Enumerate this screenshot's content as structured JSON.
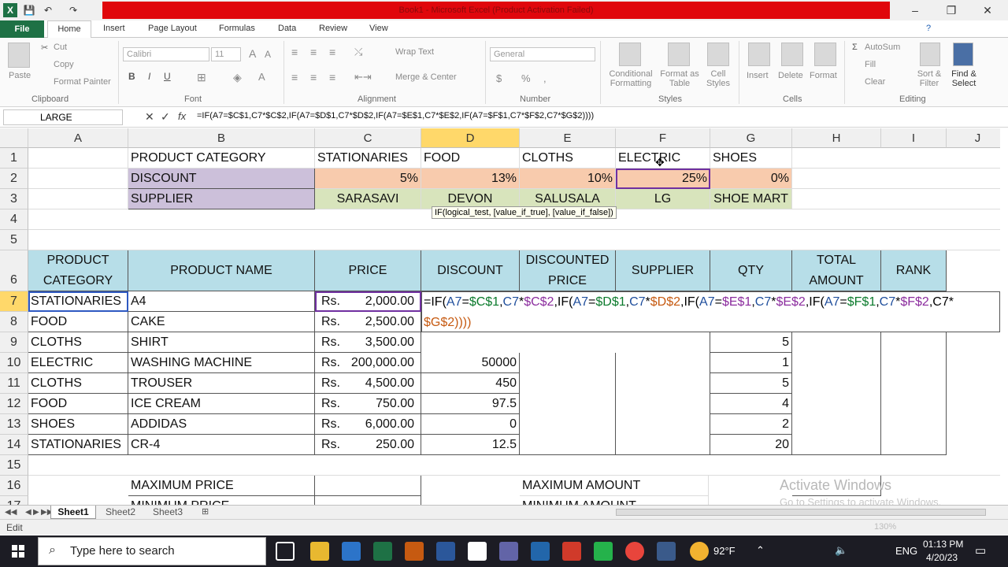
{
  "window": {
    "title_blurred": "Book1 - Microsoft Excel (Product Activation Failed)",
    "qa_excel_icon": "X",
    "qa_save": "💾",
    "qa_undo": "↶",
    "qa_redo": "↷",
    "minimize": "–",
    "restore": "❐",
    "close": "✕"
  },
  "ribbon_tabs": [
    "File",
    "Home",
    "Insert",
    "Page Layout",
    "Formulas",
    "Data",
    "Review",
    "View"
  ],
  "ribbon": {
    "paste": "Paste",
    "cut": "Cut",
    "copy": "Copy",
    "format_painter": "Format Painter",
    "clipboard": "Clipboard",
    "font_name": "Calibri",
    "font_size": "11",
    "font": "Font",
    "wrap_text": "Wrap Text",
    "merge_center": "Merge & Center",
    "alignment": "Alignment",
    "number_format": "General",
    "number": "Number",
    "conditional_formatting": "Conditional Formatting",
    "format_as_table": "Format as Table",
    "cell_styles": "Cell Styles",
    "styles": "Styles",
    "insert": "Insert",
    "delete": "Delete",
    "format": "Format",
    "cells": "Cells",
    "autosum": "AutoSum",
    "fill": "Fill",
    "clear": "Clear",
    "sort_filter": "Sort & Filter",
    "find_select": "Find & Select",
    "editing": "Editing",
    "bold": "B",
    "italic": "I",
    "underline": "U"
  },
  "formula_bar": {
    "name_box": "LARGE",
    "cancel": "✕",
    "enter": "✓",
    "fx": "fx",
    "formula": "=IF(A7=$C$1,C7*$C$2,IF(A7=$D$1,C7*$D$2,IF(A7=$E$1,C7*$E$2,IF(A7=$F$1,C7*$F$2,C7*$G$2))))"
  },
  "columns": [
    "A",
    "B",
    "C",
    "D",
    "E",
    "F",
    "G",
    "H",
    "I",
    "J"
  ],
  "rows": [
    "1",
    "2",
    "3",
    "4",
    "5",
    "6",
    "7",
    "8",
    "9",
    "10",
    "11",
    "12",
    "13",
    "14",
    "15",
    "16",
    "17"
  ],
  "header_table": {
    "b1": "PRODUCT CATEGORY",
    "b2": "DISCOUNT",
    "b3": "SUPPLIER",
    "categories": [
      "STATIONARIES",
      "FOOD",
      "CLOTHS",
      "ELECTRIC",
      "SHOES"
    ],
    "discounts": [
      "5%",
      "13%",
      "10%",
      "25%",
      "0%"
    ],
    "suppliers": [
      "SARASAVI",
      "DEVON",
      "SALUSALA",
      "LG",
      "SHOE MART"
    ]
  },
  "main_table": {
    "headers": {
      "product_category_1": "PRODUCT",
      "product_category_2": "CATEGORY",
      "product_name": "PRODUCT NAME",
      "price": "PRICE",
      "discount": "DISCOUNT",
      "discounted_price_1": "DISCOUNTED",
      "discounted_price_2": "PRICE",
      "supplier": "SUPPLIER",
      "qty": "QTY",
      "total_amount_1": "TOTAL",
      "total_amount_2": "AMOUNT",
      "rank": "RANK"
    },
    "rows": [
      {
        "category": "STATIONARIES",
        "name": "A4",
        "rs": "Rs.",
        "price": "2,000.00",
        "discount": "",
        "qty": ""
      },
      {
        "category": "FOOD",
        "name": "CAKE",
        "rs": "Rs.",
        "price": "2,500.00",
        "discount": "",
        "qty": ""
      },
      {
        "category": "CLOTHS",
        "name": "SHIRT",
        "rs": "Rs.",
        "price": "3,500.00",
        "discount": "",
        "qty": "5"
      },
      {
        "category": "ELECTRIC",
        "name": "WASHING MACHINE",
        "rs": "Rs.",
        "price": "200,000.00",
        "discount": "50000",
        "qty": "1"
      },
      {
        "category": "CLOTHS",
        "name": "TROUSER",
        "rs": "Rs.",
        "price": "4,500.00",
        "discount": "450",
        "qty": "5"
      },
      {
        "category": "FOOD",
        "name": "ICE CREAM",
        "rs": "Rs.",
        "price": "750.00",
        "discount": "97.5",
        "qty": "4"
      },
      {
        "category": "SHOES",
        "name": "ADDIDAS",
        "rs": "Rs.",
        "price": "6,000.00",
        "discount": "0",
        "qty": "2"
      },
      {
        "category": "STATIONARIES",
        "name": "CR-4",
        "rs": "Rs.",
        "price": "250.00",
        "discount": "12.5",
        "qty": "20"
      }
    ]
  },
  "edit_cell": {
    "line1_parts": [
      "=IF(",
      "A7",
      "=",
      "$C$1",
      ",",
      "C7",
      "*",
      "$C$2",
      ",IF(",
      "A7",
      "=",
      "$D$1",
      ",",
      "C7",
      "*",
      "$D$2",
      ",IF(",
      "A7",
      "=",
      "$E$1",
      ",",
      "C7",
      "*",
      "$E$2",
      ",IF(",
      "A7",
      "=",
      "$F$1",
      ",",
      "C7",
      "*",
      "$F$2",
      ",C7*"
    ],
    "line2": "$G$2))))",
    "tooltip": "IF(logical_test, [value_if_true], [value_if_false])"
  },
  "summary": {
    "max_price": "MAXIMUM PRICE",
    "min_price": "MINIMUM PRICE",
    "max_amount": "MAXIMUM AMOUNT",
    "min_amount": "MINIMUM AMOUNT"
  },
  "sheets": [
    "Sheet1",
    "Sheet2",
    "Sheet3"
  ],
  "status": {
    "mode": "Edit",
    "zoom": "130%"
  },
  "watermark": {
    "line1": "Activate Windows",
    "line2": "Go to Settings to activate Windows."
  },
  "taskbar": {
    "search_placeholder": "Type here to search",
    "weather": "92°F",
    "lang": "ENG",
    "time": "01:13 PM",
    "date": "4/20/23"
  },
  "colors": {
    "excel_green": "#1e7145",
    "purple": "#ccc0da",
    "orange": "#f8cbad",
    "green": "#d8e4bc",
    "blue": "#b7dee8"
  }
}
